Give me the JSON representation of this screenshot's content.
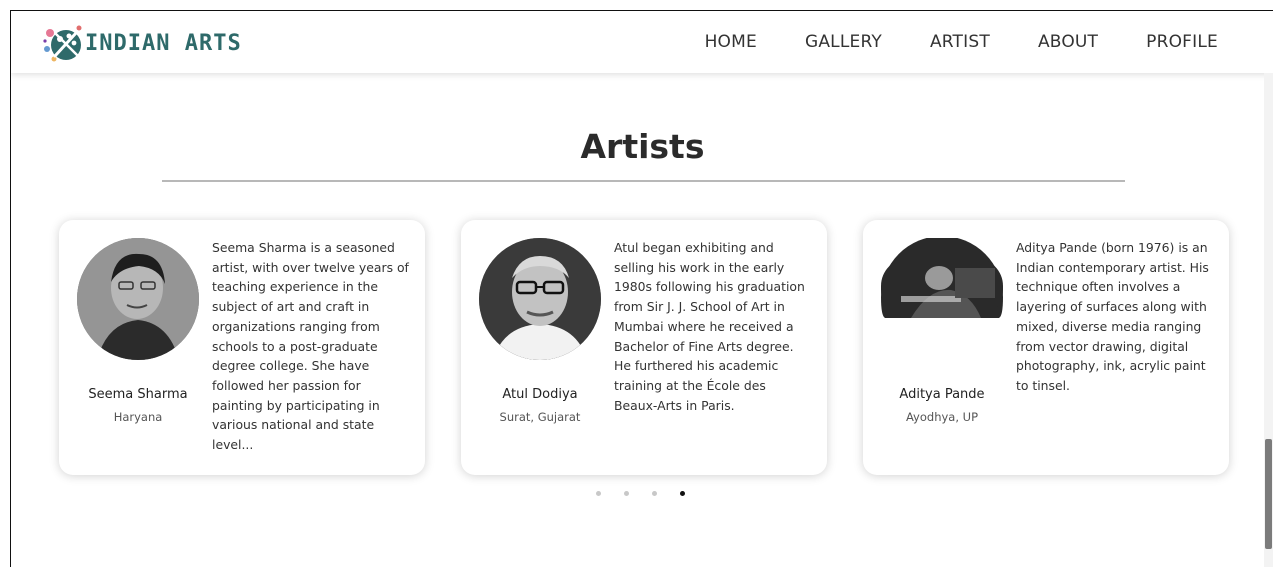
{
  "brand": {
    "name": "INDIAN ARTS",
    "color": "#2e6a6a"
  },
  "nav": {
    "items": [
      "HOME",
      "GALLERY",
      "ARTIST",
      "ABOUT",
      "PROFILE"
    ]
  },
  "section": {
    "title": "Artists"
  },
  "artists": [
    {
      "name": "Seema Sharma",
      "location": "Haryana",
      "bio": "Seema Sharma is a seasoned artist, with over twelve years of teaching experience in the subject of art and craft in organizations ranging from schools to a post-graduate degree college. She have followed her passion for painting by participating in various national and state level..."
    },
    {
      "name": "Atul Dodiya",
      "location": "Surat, Gujarat",
      "bio": "Atul began exhibiting and selling his work in the early 1980s following his graduation from Sir J. J. School of Art in Mumbai where he received a Bachelor of Fine Arts degree. He furthered his academic training at the École des Beaux-Arts in Paris."
    },
    {
      "name": "Aditya Pande",
      "location": "Ayodhya, UP",
      "bio": "Aditya Pande (born 1976) is an Indian contemporary artist. His technique often involves a layering of surfaces along with mixed, diverse media ranging from vector drawing, digital photography, ink, acrylic paint to tinsel."
    }
  ],
  "carousel": {
    "total_pages": 4,
    "active_page": 4
  }
}
